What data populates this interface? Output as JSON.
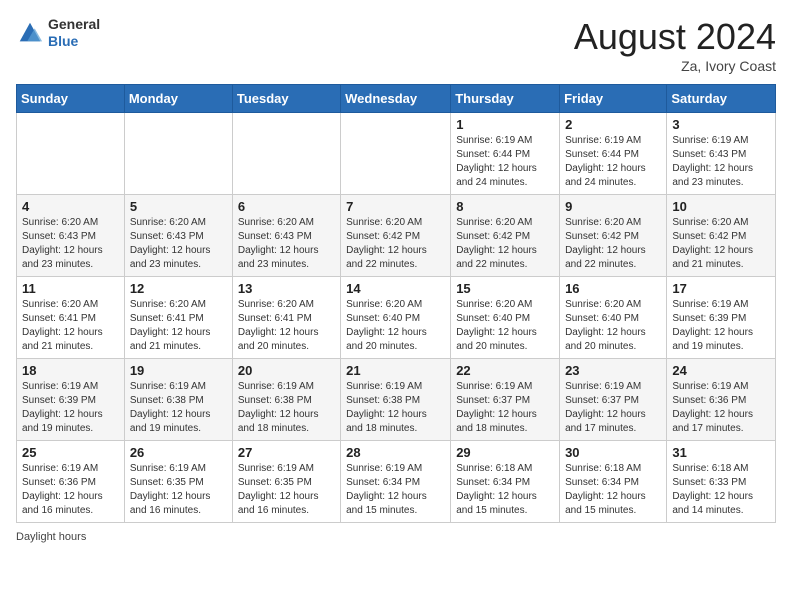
{
  "header": {
    "logo_general": "General",
    "logo_blue": "Blue",
    "month_year": "August 2024",
    "location": "Za, Ivory Coast"
  },
  "days_of_week": [
    "Sunday",
    "Monday",
    "Tuesday",
    "Wednesday",
    "Thursday",
    "Friday",
    "Saturday"
  ],
  "weeks": [
    [
      {
        "day": "",
        "info": ""
      },
      {
        "day": "",
        "info": ""
      },
      {
        "day": "",
        "info": ""
      },
      {
        "day": "",
        "info": ""
      },
      {
        "day": "1",
        "info": "Sunrise: 6:19 AM\nSunset: 6:44 PM\nDaylight: 12 hours\nand 24 minutes."
      },
      {
        "day": "2",
        "info": "Sunrise: 6:19 AM\nSunset: 6:44 PM\nDaylight: 12 hours\nand 24 minutes."
      },
      {
        "day": "3",
        "info": "Sunrise: 6:19 AM\nSunset: 6:43 PM\nDaylight: 12 hours\nand 23 minutes."
      }
    ],
    [
      {
        "day": "4",
        "info": "Sunrise: 6:20 AM\nSunset: 6:43 PM\nDaylight: 12 hours\nand 23 minutes."
      },
      {
        "day": "5",
        "info": "Sunrise: 6:20 AM\nSunset: 6:43 PM\nDaylight: 12 hours\nand 23 minutes."
      },
      {
        "day": "6",
        "info": "Sunrise: 6:20 AM\nSunset: 6:43 PM\nDaylight: 12 hours\nand 23 minutes."
      },
      {
        "day": "7",
        "info": "Sunrise: 6:20 AM\nSunset: 6:42 PM\nDaylight: 12 hours\nand 22 minutes."
      },
      {
        "day": "8",
        "info": "Sunrise: 6:20 AM\nSunset: 6:42 PM\nDaylight: 12 hours\nand 22 minutes."
      },
      {
        "day": "9",
        "info": "Sunrise: 6:20 AM\nSunset: 6:42 PM\nDaylight: 12 hours\nand 22 minutes."
      },
      {
        "day": "10",
        "info": "Sunrise: 6:20 AM\nSunset: 6:42 PM\nDaylight: 12 hours\nand 21 minutes."
      }
    ],
    [
      {
        "day": "11",
        "info": "Sunrise: 6:20 AM\nSunset: 6:41 PM\nDaylight: 12 hours\nand 21 minutes."
      },
      {
        "day": "12",
        "info": "Sunrise: 6:20 AM\nSunset: 6:41 PM\nDaylight: 12 hours\nand 21 minutes."
      },
      {
        "day": "13",
        "info": "Sunrise: 6:20 AM\nSunset: 6:41 PM\nDaylight: 12 hours\nand 20 minutes."
      },
      {
        "day": "14",
        "info": "Sunrise: 6:20 AM\nSunset: 6:40 PM\nDaylight: 12 hours\nand 20 minutes."
      },
      {
        "day": "15",
        "info": "Sunrise: 6:20 AM\nSunset: 6:40 PM\nDaylight: 12 hours\nand 20 minutes."
      },
      {
        "day": "16",
        "info": "Sunrise: 6:20 AM\nSunset: 6:40 PM\nDaylight: 12 hours\nand 20 minutes."
      },
      {
        "day": "17",
        "info": "Sunrise: 6:19 AM\nSunset: 6:39 PM\nDaylight: 12 hours\nand 19 minutes."
      }
    ],
    [
      {
        "day": "18",
        "info": "Sunrise: 6:19 AM\nSunset: 6:39 PM\nDaylight: 12 hours\nand 19 minutes."
      },
      {
        "day": "19",
        "info": "Sunrise: 6:19 AM\nSunset: 6:38 PM\nDaylight: 12 hours\nand 19 minutes."
      },
      {
        "day": "20",
        "info": "Sunrise: 6:19 AM\nSunset: 6:38 PM\nDaylight: 12 hours\nand 18 minutes."
      },
      {
        "day": "21",
        "info": "Sunrise: 6:19 AM\nSunset: 6:38 PM\nDaylight: 12 hours\nand 18 minutes."
      },
      {
        "day": "22",
        "info": "Sunrise: 6:19 AM\nSunset: 6:37 PM\nDaylight: 12 hours\nand 18 minutes."
      },
      {
        "day": "23",
        "info": "Sunrise: 6:19 AM\nSunset: 6:37 PM\nDaylight: 12 hours\nand 17 minutes."
      },
      {
        "day": "24",
        "info": "Sunrise: 6:19 AM\nSunset: 6:36 PM\nDaylight: 12 hours\nand 17 minutes."
      }
    ],
    [
      {
        "day": "25",
        "info": "Sunrise: 6:19 AM\nSunset: 6:36 PM\nDaylight: 12 hours\nand 16 minutes."
      },
      {
        "day": "26",
        "info": "Sunrise: 6:19 AM\nSunset: 6:35 PM\nDaylight: 12 hours\nand 16 minutes."
      },
      {
        "day": "27",
        "info": "Sunrise: 6:19 AM\nSunset: 6:35 PM\nDaylight: 12 hours\nand 16 minutes."
      },
      {
        "day": "28",
        "info": "Sunrise: 6:19 AM\nSunset: 6:34 PM\nDaylight: 12 hours\nand 15 minutes."
      },
      {
        "day": "29",
        "info": "Sunrise: 6:18 AM\nSunset: 6:34 PM\nDaylight: 12 hours\nand 15 minutes."
      },
      {
        "day": "30",
        "info": "Sunrise: 6:18 AM\nSunset: 6:34 PM\nDaylight: 12 hours\nand 15 minutes."
      },
      {
        "day": "31",
        "info": "Sunrise: 6:18 AM\nSunset: 6:33 PM\nDaylight: 12 hours\nand 14 minutes."
      }
    ]
  ],
  "footer": {
    "note": "Daylight hours"
  },
  "colors": {
    "header_bg": "#2a6db5",
    "header_text": "#ffffff"
  }
}
